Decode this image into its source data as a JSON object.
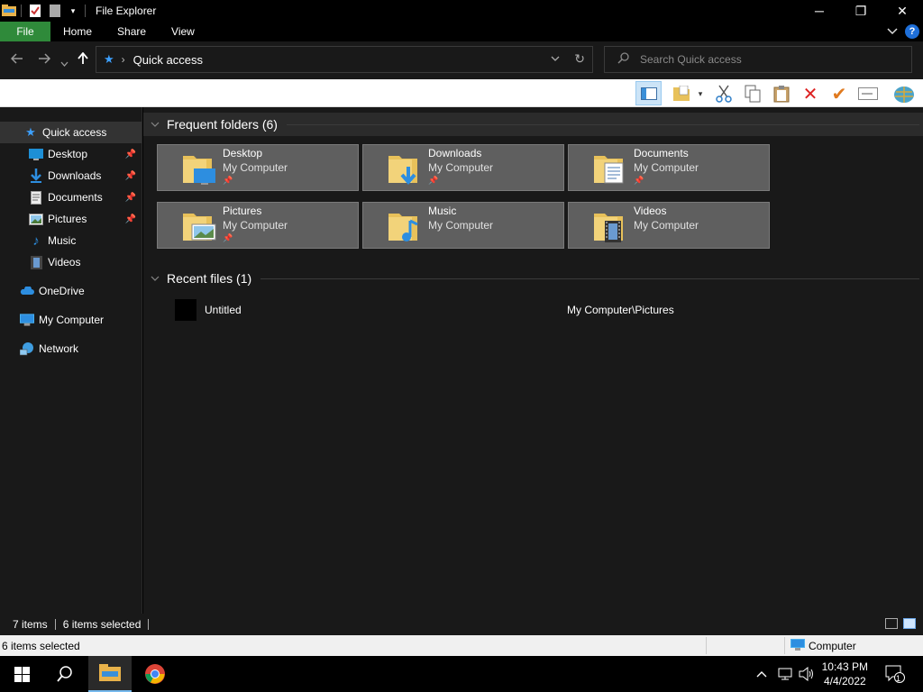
{
  "window": {
    "title": "File Explorer",
    "minimize": "─",
    "maximize": "❐",
    "close": "✕"
  },
  "ribbon": {
    "tabs": [
      "File",
      "Home",
      "Share",
      "View"
    ],
    "expand_icon": "chevron-down-icon",
    "help": "?"
  },
  "address": {
    "path": "Quick access",
    "search_placeholder": "Search Quick access"
  },
  "nav": {
    "items": [
      {
        "label": "Quick access",
        "icon": "star-icon",
        "pinned": false
      },
      {
        "label": "Desktop",
        "icon": "desktop-icon",
        "pinned": true
      },
      {
        "label": "Downloads",
        "icon": "downloads-icon",
        "pinned": true
      },
      {
        "label": "Documents",
        "icon": "documents-icon",
        "pinned": true
      },
      {
        "label": "Pictures",
        "icon": "pictures-icon",
        "pinned": true
      },
      {
        "label": "Music",
        "icon": "music-icon",
        "pinned": false
      },
      {
        "label": "Videos",
        "icon": "videos-icon",
        "pinned": false
      },
      {
        "label": "OneDrive",
        "icon": "onedrive-icon",
        "pinned": false
      },
      {
        "label": "My Computer",
        "icon": "computer-icon",
        "pinned": false
      },
      {
        "label": "Network",
        "icon": "network-icon",
        "pinned": false
      }
    ]
  },
  "frequent": {
    "header": "Frequent folders (6)",
    "tiles": [
      {
        "name": "Desktop",
        "sub": "My Computer",
        "pinned": true
      },
      {
        "name": "Downloads",
        "sub": "My Computer",
        "pinned": true
      },
      {
        "name": "Documents",
        "sub": "My Computer",
        "pinned": true
      },
      {
        "name": "Pictures",
        "sub": "My Computer",
        "pinned": true
      },
      {
        "name": "Music",
        "sub": "My Computer",
        "pinned": false
      },
      {
        "name": "Videos",
        "sub": "My Computer",
        "pinned": false
      }
    ]
  },
  "recent": {
    "header": "Recent files (1)",
    "files": [
      {
        "name": "Untitled",
        "path": "My Computer\\Pictures"
      }
    ]
  },
  "status": {
    "items": "7 items",
    "selected": "6 items selected"
  },
  "status2": {
    "left": "6 items selected",
    "right": "Computer"
  },
  "taskbar": {
    "time": "10:43 PM",
    "date": "4/4/2022",
    "notifications": "1"
  },
  "colors": {
    "file_tab": "#2f8a3a",
    "accent": "#3da0ff",
    "tile_bg": "#5f5f5f"
  }
}
